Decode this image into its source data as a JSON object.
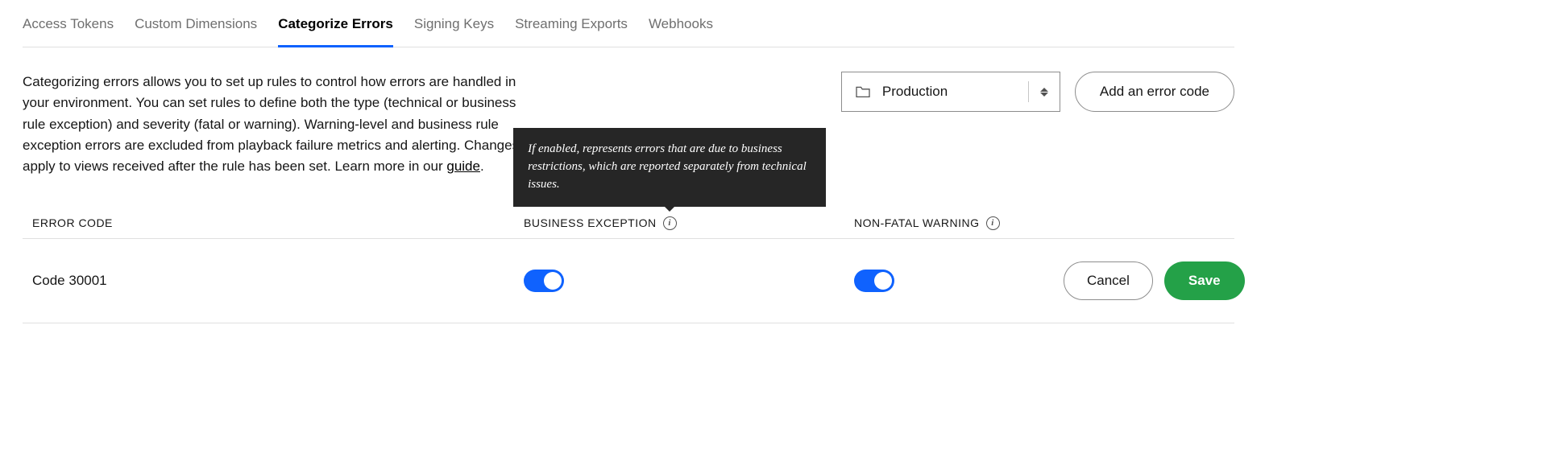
{
  "tabs": [
    "Access Tokens",
    "Custom Dimensions",
    "Categorize Errors",
    "Signing Keys",
    "Streaming Exports",
    "Webhooks"
  ],
  "active_tab_index": 2,
  "description_pre": "Categorizing errors allows you to set up rules to control how errors are handled in your environment. You can set rules to define both the type (technical or business rule exception) and severity (fatal or warning). Warning-level and business rule exception errors are excluded from playback failure metrics and alerting. Changes apply to views received after the rule has been set. Learn more in our ",
  "description_link": "guide",
  "description_post": ".",
  "environment": {
    "selected": "Production"
  },
  "add_button_label": "Add an error code",
  "columns": {
    "code": "ERROR CODE",
    "business": "BUSINESS EXCEPTION",
    "warning": "NON-FATAL WARNING"
  },
  "tooltip_business": "If enabled, represents errors that are due to business restrictions, which are reported separately from technical issues.",
  "rows": [
    {
      "code": "Code 30001",
      "business_exception": true,
      "non_fatal_warning": true
    }
  ],
  "buttons": {
    "cancel": "Cancel",
    "save": "Save"
  },
  "icons": {
    "info_glyph": "i"
  }
}
